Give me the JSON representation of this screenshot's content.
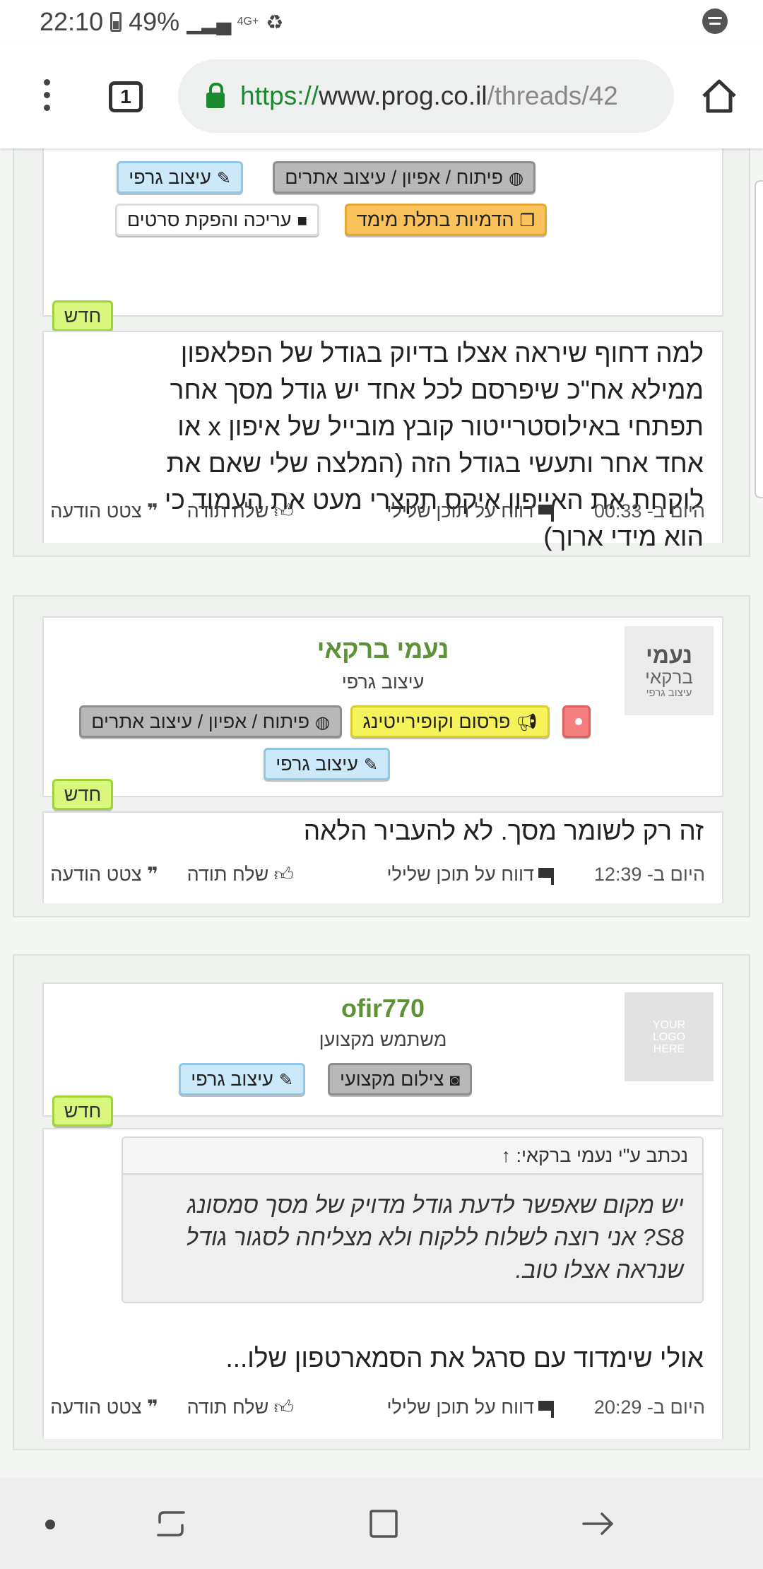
{
  "status_bar": {
    "time": "22:10",
    "battery": "49%",
    "network": "4G+"
  },
  "browser": {
    "tab_count": "1",
    "url_scheme": "https://",
    "url_host": "www.prog.co.il",
    "url_path": "/threads/42"
  },
  "post1": {
    "tags": {
      "graphic_design": "עיצוב גרפי",
      "dev": "פיתוח / אפיון / עיצוב אתרים",
      "video": "עריכה והפקת סרטים",
      "three_d": "הדמיות בתלת מימד"
    },
    "new_badge": "חדש",
    "text": "למה דחוף שיראה אצלו בדיוק בגודל של הפלאפון ממילא אח\"כ שיפרסם לכל אחד יש גודל מסך אחר תפתחי באילוסטרייטור קובץ מובייל של איפון x או אחד אחר ותעשי בגודל הזה (המלצה שלי שאם את לוקחת את האייפון איקס תקצרי מעט את העמוד כי הוא מידי ארוך)",
    "footer": {
      "date": "היום ב- 00:33",
      "report": "דווח על תוכן שלילי",
      "thanks": "שלח תודה",
      "quote": "צטט הודעה"
    }
  },
  "post2": {
    "username": "נעמי ברקאי",
    "user_title": "עיצוב גרפי",
    "avatar_line1": "נעמי",
    "avatar_line2": "ברקאי",
    "avatar_line3": "עיצוב גרפי",
    "tags": {
      "marketing": "פרסום וקופירייטינג",
      "dev": "פיתוח / אפיון / עיצוב אתרים",
      "graphic_design": "עיצוב גרפי"
    },
    "new_badge": "חדש",
    "text": "זה רק לשומר מסך. לא להעביר הלאה",
    "footer": {
      "date": "היום ב- 12:39",
      "report": "דווח על תוכן שלילי",
      "thanks": "שלח תודה",
      "quote": "צטט הודעה"
    }
  },
  "post3": {
    "username": "ofir770",
    "user_title": "משתמש מקצוען",
    "avatar_text": "YOUR LOGO HERE",
    "tags": {
      "photo": "צילום מקצועי",
      "graphic_design": "עיצוב גרפי"
    },
    "new_badge": "חדש",
    "quote_header": "נכתב ע\"י נעמי ברקאי: ↑",
    "quote_text": "יש מקום שאפשר לדעת גודל מדויק של מסך סמסונג S8? אני רוצה לשלוח ללקוח ולא מצליחה לסגור גודל שנראה אצלו טוב.",
    "text": "אולי שימדוד עם סרגל את הסמארטפון שלו...",
    "footer": {
      "date": "היום ב- 20:29",
      "report": "דווח על תוכן שלילי",
      "thanks": "שלח תודה",
      "quote": "צטט הודעה"
    }
  }
}
